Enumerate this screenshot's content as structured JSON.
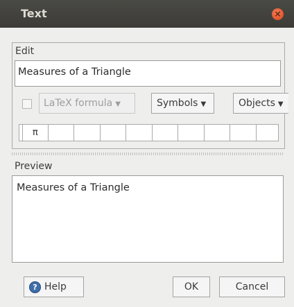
{
  "window": {
    "title": "Text",
    "close_glyph": "×"
  },
  "edit": {
    "label": "Edit",
    "value": "Measures of a Triangle",
    "latex_checkbox_checked": false,
    "latex_label": "LaTeX formula",
    "symbols_label": "Symbols",
    "objects_label": "Objects",
    "symbol_strip": [
      "π",
      "",
      "",
      "",
      "",
      "",
      "",
      "",
      "",
      ""
    ]
  },
  "preview": {
    "label": "Preview",
    "text": "Measures of a Triangle"
  },
  "buttons": {
    "help": "Help",
    "help_icon_glyph": "?",
    "ok": "OK",
    "cancel": "Cancel"
  },
  "icons": {
    "close": "close-icon",
    "help": "help-icon",
    "dropdown": "chevron-down-icon"
  },
  "colors": {
    "titlebar": "#3c3b37",
    "close_button": "#e25a2b",
    "help_icon": "#3f6fa8"
  }
}
